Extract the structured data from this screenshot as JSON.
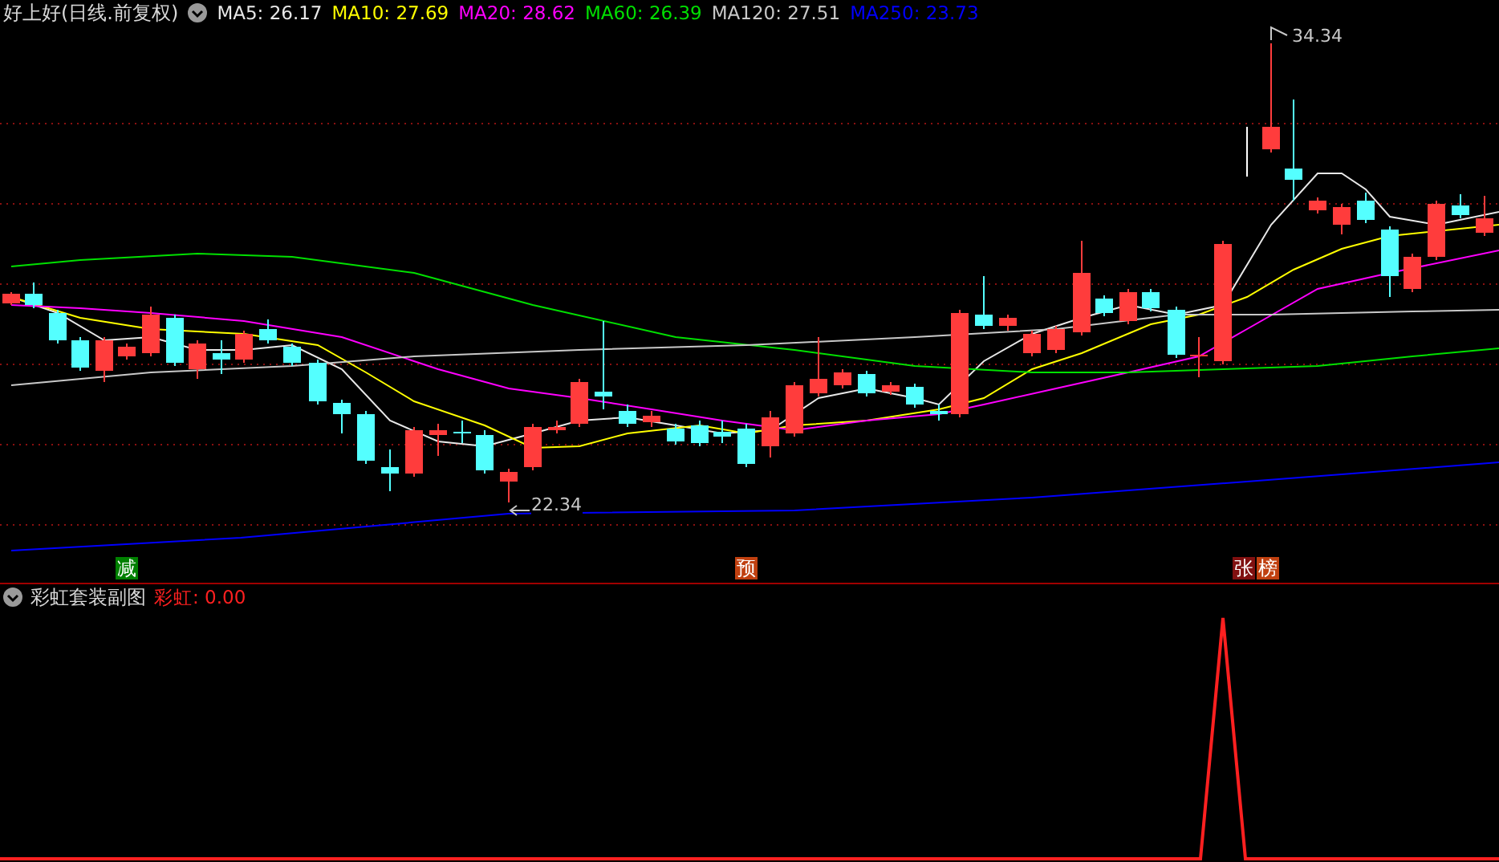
{
  "main_chart": {
    "title": "好上好(日线.前复权)",
    "moving_averages": [
      {
        "label": "MA5: 26.17",
        "color": "#e8e8e8"
      },
      {
        "label": "MA10: 27.69",
        "color": "#ffff00"
      },
      {
        "label": "MA20: 28.62",
        "color": "#ff00ff"
      },
      {
        "label": "MA60: 26.39",
        "color": "#00e000"
      },
      {
        "label": "MA120: 27.51",
        "color": "#c8c8c8"
      },
      {
        "label": "MA250: 23.73",
        "color": "#0000ff"
      }
    ],
    "high_label": "34.34",
    "low_label": "22.34",
    "signals": [
      {
        "text": "减",
        "color": "#008000"
      },
      {
        "text": "预",
        "color": "#c04010"
      },
      {
        "text": "张",
        "color": "#801010"
      },
      {
        "text": "榜",
        "color": "#c04010"
      }
    ]
  },
  "sub_chart": {
    "title": "彩虹套装副图",
    "indicator": "彩虹: 0.00"
  }
}
